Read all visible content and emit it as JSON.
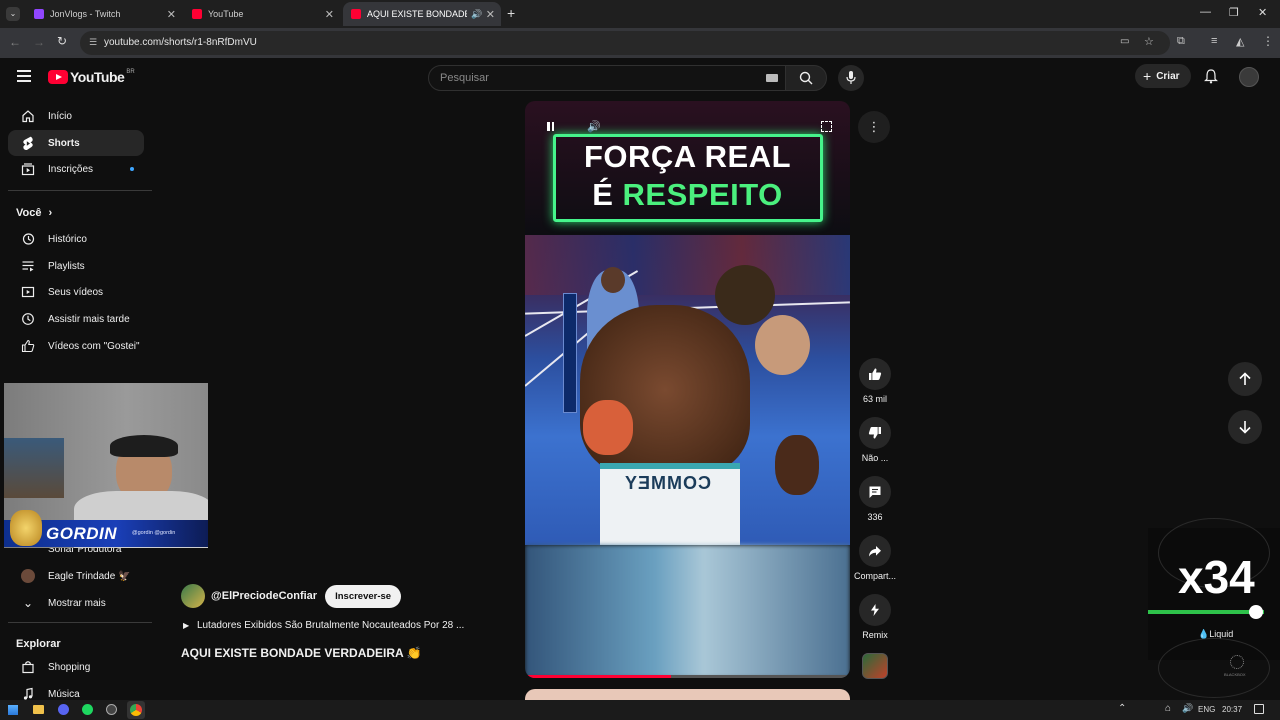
{
  "browser": {
    "tabs": [
      {
        "label": "JonVlogs - Twitch",
        "color": "#9146ff"
      },
      {
        "label": "YouTube",
        "color": "#ff0033"
      },
      {
        "label": "AQUI EXISTE BONDADE VE",
        "color": "#ff0033"
      }
    ],
    "url": "youtube.com/shorts/r1-8nRfDmVU"
  },
  "header": {
    "logo": "YouTube",
    "region": "BR",
    "search_placeholder": "Pesquisar",
    "create_label": "Criar"
  },
  "sidebar": {
    "main": [
      {
        "label": "Início",
        "icon": "home-icon"
      },
      {
        "label": "Shorts",
        "icon": "shorts-icon"
      },
      {
        "label": "Inscrições",
        "icon": "subscriptions-icon"
      }
    ],
    "you_title": "Você",
    "you": [
      {
        "label": "Histórico",
        "icon": "history-icon"
      },
      {
        "label": "Playlists",
        "icon": "playlists-icon"
      },
      {
        "label": "Seus vídeos",
        "icon": "your-videos-icon"
      },
      {
        "label": "Assistir mais tarde",
        "icon": "watch-later-icon"
      },
      {
        "label": "Vídeos com \"Gostei\"",
        "icon": "liked-icon"
      }
    ],
    "partial_item": "Sonar Produtora",
    "subs": [
      {
        "label": "Eagle Trindade 🦅"
      }
    ],
    "show_more": "Mostrar mais",
    "explore_title": "Explorar",
    "explore": [
      {
        "label": "Shopping"
      },
      {
        "label": "Música"
      }
    ]
  },
  "overlay": {
    "name": "GORDIN",
    "handles": "@gordin  @gordin"
  },
  "short": {
    "overlay_line1": "FORÇA REAL",
    "overlay_line2_white": "É",
    "overlay_line2_green": "RESPEITO",
    "trunks_text": "COMMEY",
    "channel": "@ElPreciodeConfiar",
    "subscribe": "Inscrever-se",
    "playlist": "Lutadores Exibidos São Brutalmente Nocauteados Por 28 ...",
    "title": "AQUI EXISTE BONDADE VERDADEIRA 👏",
    "progress": 0.45
  },
  "actions": {
    "likes": "63 mil",
    "dislike": "Não ...",
    "comments": "336",
    "share": "Compart...",
    "remix": "Remix"
  },
  "widget": {
    "multiplier": "x34",
    "label": "Liquid",
    "brand": "BLACKBOX"
  },
  "taskbar": {
    "lang": "ENG",
    "time": "20:37"
  }
}
